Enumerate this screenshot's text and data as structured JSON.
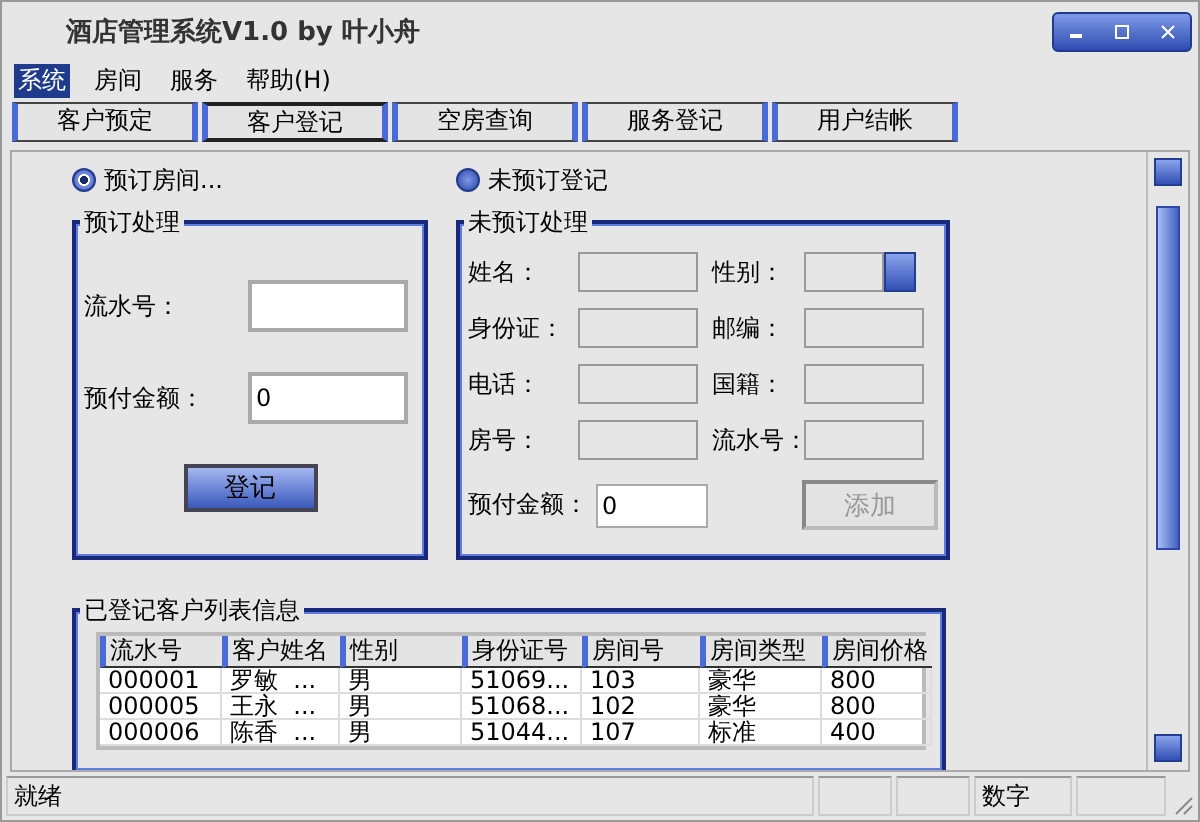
{
  "window": {
    "title": "酒店管理系统V1.0 by 叶小舟"
  },
  "menu": [
    {
      "label": "系统",
      "selected": true
    },
    {
      "label": "房间",
      "selected": false
    },
    {
      "label": "服务",
      "selected": false
    },
    {
      "label": "帮助(H)",
      "selected": false
    }
  ],
  "tabs": [
    {
      "label": "客户预定",
      "selected": false
    },
    {
      "label": "客户登记",
      "selected": true
    },
    {
      "label": "空房查询",
      "selected": false
    },
    {
      "label": "服务登记",
      "selected": false
    },
    {
      "label": "用户结帐",
      "selected": false
    }
  ],
  "booking": {
    "radio": {
      "label": "预订房间...",
      "selected": true
    },
    "group_title": "预订处理",
    "fields": [
      {
        "label": "流水号："
      },
      {
        "label": "预付金额：",
        "value": "0"
      }
    ],
    "button": "登记"
  },
  "walk_in": {
    "radio": {
      "label": "未预订登记",
      "selected": false
    },
    "group_title": "未预订处理",
    "fields": [
      {
        "label": "姓名：",
        "kind": "text"
      },
      {
        "label": "性别：",
        "kind": "combo"
      },
      {
        "label": "身份证：",
        "kind": "text"
      },
      {
        "label": "邮编：",
        "kind": "text"
      },
      {
        "label": "电话：",
        "kind": "text"
      },
      {
        "label": "国籍：",
        "kind": "text"
      },
      {
        "label": "房号：",
        "kind": "text"
      },
      {
        "label": "流水号：",
        "kind": "text"
      }
    ],
    "prepaid": {
      "label": "预付金额：",
      "value": "0"
    },
    "button": {
      "label": "添加",
      "disabled": true
    }
  },
  "customers": {
    "group_title": "已登记客户列表信息",
    "columns": [
      "流水号",
      "客户姓名",
      "性别",
      "身份证号",
      "房间号",
      "房间类型",
      "房间价格"
    ],
    "rows": [
      [
        "000001",
        "罗敏  ...",
        "男",
        "51069...",
        "103",
        "豪华",
        "800"
      ],
      [
        "000005",
        "王永  ...",
        "男",
        "51068...",
        "102",
        "豪华",
        "800"
      ],
      [
        "000006",
        "陈香  ...",
        "男",
        "51044...",
        "107",
        "标准",
        "400"
      ]
    ]
  },
  "status_bar": {
    "message": "就绪",
    "indicator": "数字"
  }
}
